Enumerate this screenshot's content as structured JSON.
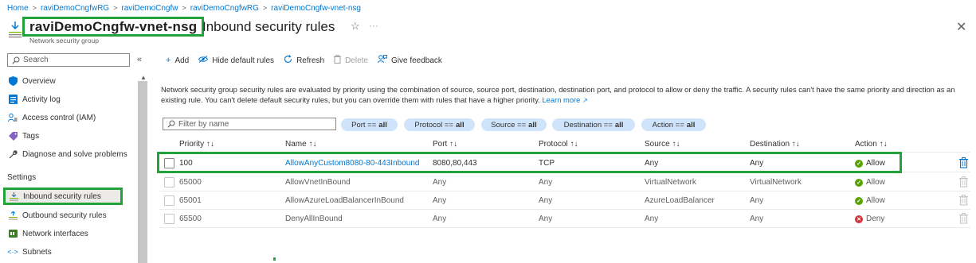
{
  "breadcrumb": [
    "Home",
    "raviDemoCngfwRG",
    "raviDemoCngfw",
    "raviDemoCngfwRG",
    "raviDemoCngfw-vnet-nsg"
  ],
  "header": {
    "resource_name": "raviDemoCngfw-vnet-nsg",
    "page_title": "Inbound security rules",
    "subtitle": "Network security group",
    "star": "☆",
    "more": "···",
    "close": "✕"
  },
  "sidebar": {
    "search_placeholder": "Search",
    "collapse": "«",
    "items": [
      {
        "label": "Overview",
        "icon": "shield-icon"
      },
      {
        "label": "Activity log",
        "icon": "activity-log-icon"
      },
      {
        "label": "Access control (IAM)",
        "icon": "iam-icon"
      },
      {
        "label": "Tags",
        "icon": "tag-icon"
      },
      {
        "label": "Diagnose and solve problems",
        "icon": "wrench-icon"
      }
    ],
    "settings_section": "Settings",
    "settings_items": [
      {
        "label": "Inbound security rules",
        "icon": "inbound-rules-icon",
        "selected": true
      },
      {
        "label": "Outbound security rules",
        "icon": "outbound-rules-icon"
      },
      {
        "label": "Network interfaces",
        "icon": "network-interface-icon"
      },
      {
        "label": "Subnets",
        "icon": "subnet-icon"
      }
    ]
  },
  "toolbar": {
    "add": "Add",
    "hide_defaults": "Hide default rules",
    "refresh": "Refresh",
    "delete": "Delete",
    "feedback": "Give feedback"
  },
  "description": {
    "text": "Network security group security rules are evaluated by priority using the combination of source, source port, destination, destination port, and protocol to allow or deny the traffic. A security rules can't have the same priority and direction as an existing rule. You can't delete default security rules, but you can override them with rules that have a higher priority.",
    "learn_more": "Learn more"
  },
  "filters": {
    "placeholder": "Filter by name",
    "pills": [
      {
        "label": "Port ==",
        "value": "all"
      },
      {
        "label": "Protocol ==",
        "value": "all"
      },
      {
        "label": "Source ==",
        "value": "all"
      },
      {
        "label": "Destination ==",
        "value": "all"
      },
      {
        "label": "Action ==",
        "value": "all"
      }
    ]
  },
  "table": {
    "columns": [
      "Priority ↑↓",
      "Name ↑↓",
      "Port ↑↓",
      "Protocol ↑↓",
      "Source ↑↓",
      "Destination ↑↓",
      "Action ↑↓"
    ],
    "rows": [
      {
        "priority": "100",
        "name": "AllowAnyCustom8080-80-443Inbound",
        "port": "8080,80,443",
        "protocol": "TCP",
        "source": "Any",
        "destination": "Any",
        "action": "Allow"
      },
      {
        "priority": "65000",
        "name": "AllowVnetInBound",
        "port": "Any",
        "protocol": "Any",
        "source": "VirtualNetwork",
        "destination": "VirtualNetwork",
        "action": "Allow"
      },
      {
        "priority": "65001",
        "name": "AllowAzureLoadBalancerInBound",
        "port": "Any",
        "protocol": "Any",
        "source": "AzureLoadBalancer",
        "destination": "Any",
        "action": "Allow"
      },
      {
        "priority": "65500",
        "name": "DenyAllInBound",
        "port": "Any",
        "protocol": "Any",
        "source": "Any",
        "destination": "Any",
        "action": "Deny"
      }
    ]
  },
  "colors": {
    "accent": "#0078d4",
    "highlight": "#22a339",
    "allow": "#57a300",
    "deny": "#d13438",
    "pill": "#cfe4fa"
  }
}
